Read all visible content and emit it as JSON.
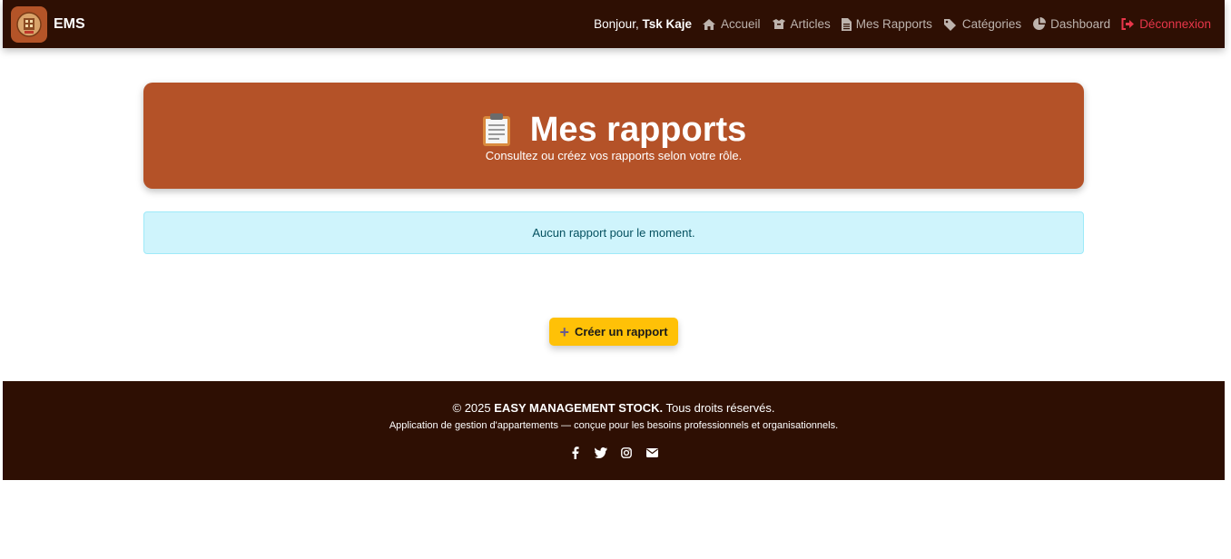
{
  "navbar": {
    "brand": "EMS",
    "greeting_prefix": "Bonjour,",
    "user_name": "Tsk Kaje",
    "links": [
      {
        "label": "Accueil",
        "icon": "home-icon"
      },
      {
        "label": "Articles",
        "icon": "box-icon"
      },
      {
        "label": "Mes Rapports",
        "icon": "file-icon"
      },
      {
        "label": "Catégories",
        "icon": "tags-icon"
      },
      {
        "label": "Dashboard",
        "icon": "pie-chart-icon"
      },
      {
        "label": "Déconnexion",
        "icon": "logout-icon"
      }
    ]
  },
  "hero": {
    "icon": "clipboard-icon",
    "title": "Mes rapports",
    "subtitle": "Consultez ou créez vos rapports selon votre rôle."
  },
  "alert": {
    "message": "Aucun rapport pour le moment."
  },
  "create_button": {
    "label": "Créer un rapport",
    "icon": "plus-icon"
  },
  "footer": {
    "copyright_prefix": "© 2025",
    "company": "EASY MANAGEMENT STOCK.",
    "rights": "Tous droits réservés.",
    "tagline": "Application de gestion d'appartements — conçue pour les besoins professionnels et organisationnels.",
    "socials": [
      "facebook-icon",
      "twitter-icon",
      "instagram-icon",
      "envelope-icon"
    ]
  },
  "colors": {
    "navbar_bg": "#2e0f03",
    "hero_bg": "#b45228",
    "alert_bg": "#cff4fc",
    "button_bg": "#ffc107",
    "logout": "#e8364a"
  }
}
